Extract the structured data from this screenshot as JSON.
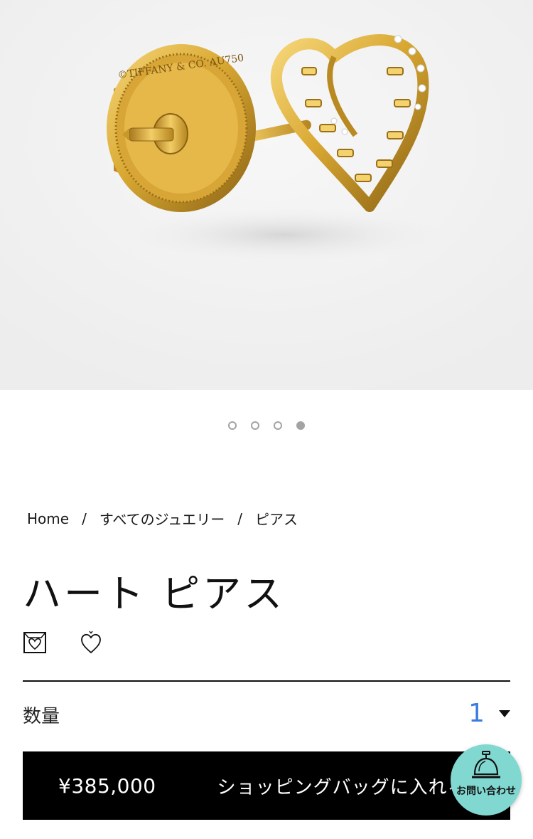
{
  "colors": {
    "hero_background": "#f3f3f3",
    "gold": "#d9a832",
    "accent_blue": "#3b7ddd",
    "contact_bubble": "#81d8d0",
    "buy_bar": "#000000"
  },
  "hero": {
    "image_alt": "yellow gold heart stud earring with diamonds, back view",
    "back_stamp": "©TIFFANY & CO. AU750"
  },
  "carousel": {
    "count": 4,
    "active_index": 3
  },
  "breadcrumb": {
    "home": "Home",
    "separator": "/",
    "category": "すべてのジュエリー",
    "current": "ピアス"
  },
  "product": {
    "title": "ハート ピアス"
  },
  "actions": {
    "icons": [
      "gift-box-heart-icon",
      "heart-favorite-icon"
    ]
  },
  "quantity": {
    "label": "数量",
    "value": "1"
  },
  "buy": {
    "price": "¥385,000",
    "add_to_bag_label": "ショッピングバッグに入れる"
  },
  "contact": {
    "label": "お問い合わせ"
  }
}
